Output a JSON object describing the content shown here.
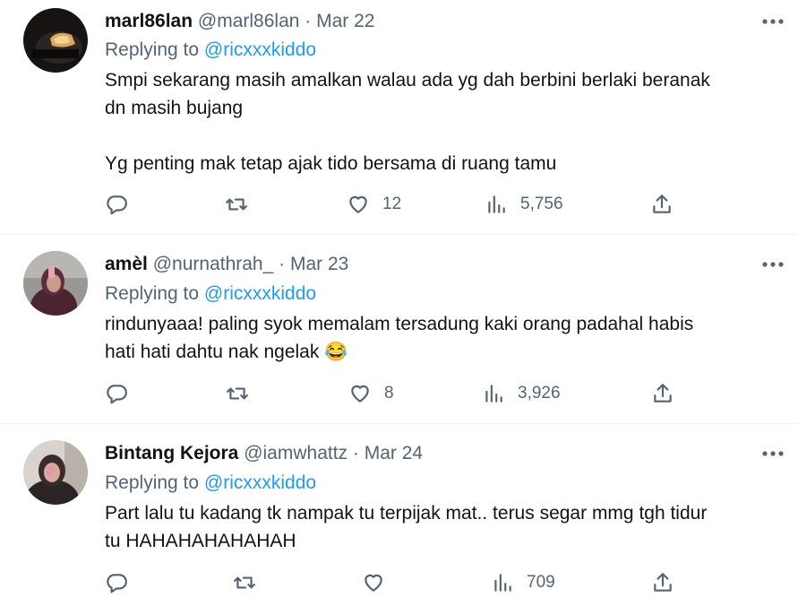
{
  "tweets": [
    {
      "name": "marl86lan",
      "handle": "@marl86lan",
      "separator": "·",
      "date": "Mar 22",
      "replying_prefix": "Replying to ",
      "replying_to": "@ricxxxkiddo",
      "text": "Smpi sekarang masih amalkan walau ada yg dah berbini berlaki beranak\ndn masih bujang\n\nYg penting mak tetap ajak tido bersama di ruang tamu",
      "likes": "12",
      "views": "5,756"
    },
    {
      "name": "amèl",
      "handle": "@nurnathrah_",
      "separator": "·",
      "date": "Mar 23",
      "replying_prefix": "Replying to ",
      "replying_to": "@ricxxxkiddo",
      "text": "rindunyaaa! paling syok memalam tersadung kaki orang padahal habis\nhati hati dahtu nak ngelak 😂",
      "likes": "8",
      "views": "3,926"
    },
    {
      "name": "Bintang Kejora",
      "handle": "@iamwhattz",
      "separator": "·",
      "date": "Mar 24",
      "replying_prefix": "Replying to ",
      "replying_to": "@ricxxxkiddo",
      "text": "Part lalu tu kadang tk nampak tu terpijak mat.. terus segar mmg tgh tidur\ntu HAHAHAHAHAHAH",
      "likes": "",
      "views": "709"
    }
  ],
  "icons": {
    "more": "more-horizontal-icon",
    "reply": "reply-bubble-icon",
    "retweet": "retweet-icon",
    "like": "heart-icon",
    "views": "analytics-bars-icon",
    "share": "share-upload-icon"
  },
  "colors": {
    "text": "#0f1419",
    "muted": "#536471",
    "link": "#1d9bf0",
    "divider": "#eff3f4"
  }
}
